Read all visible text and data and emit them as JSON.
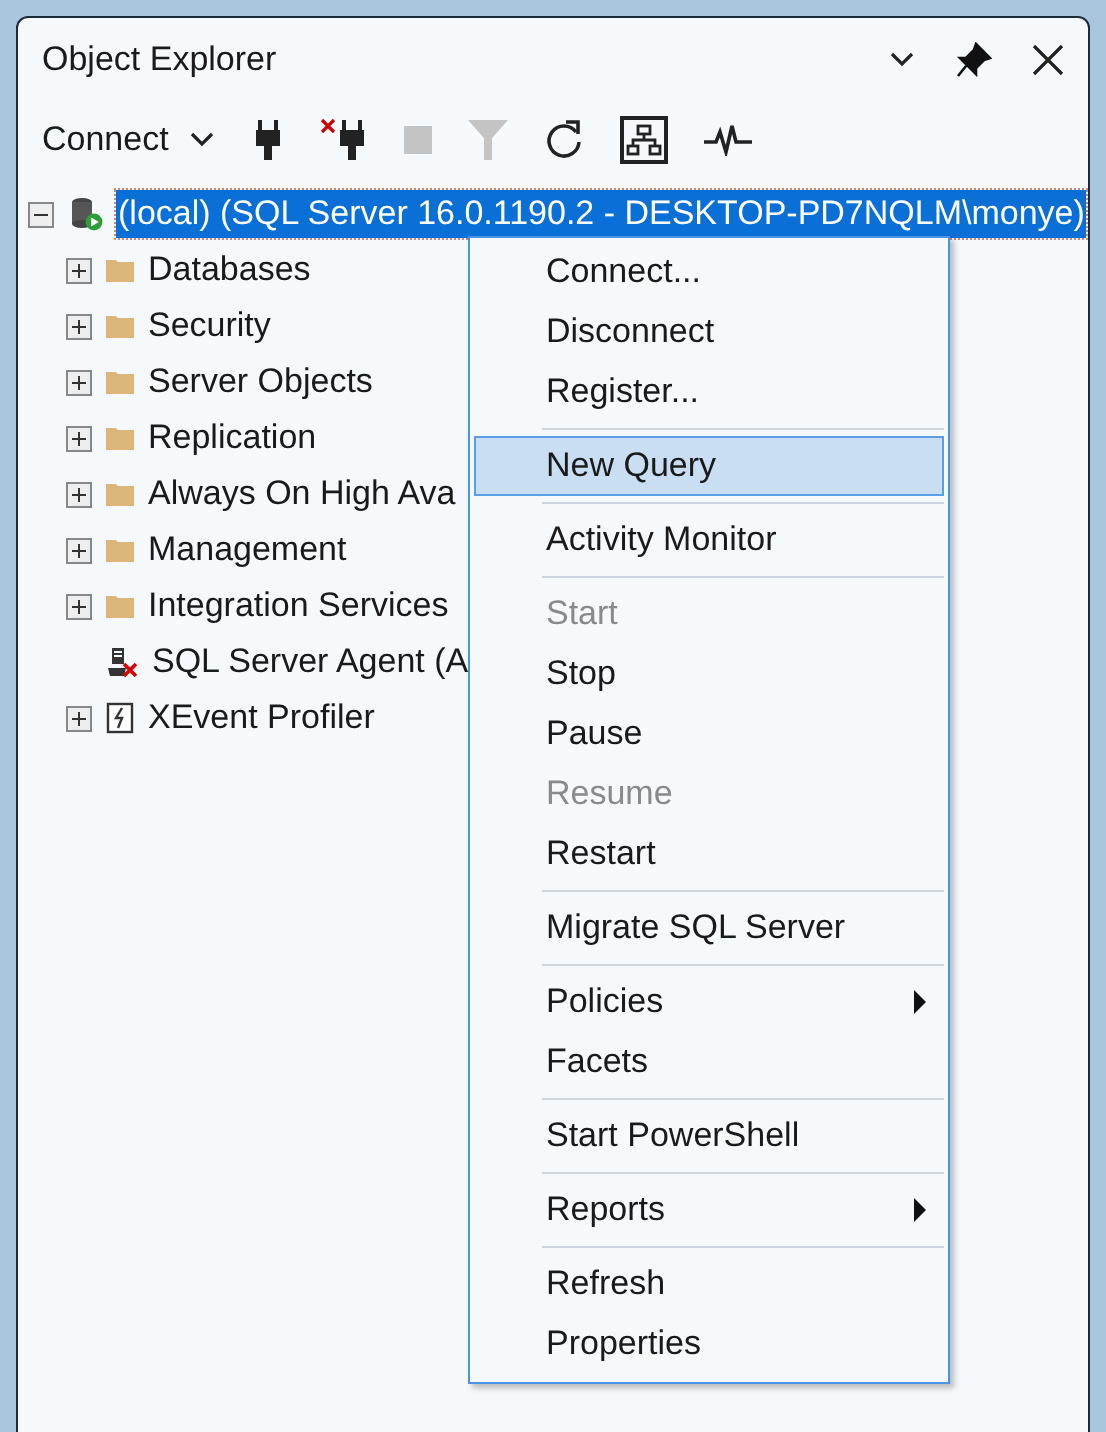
{
  "panel": {
    "title": "Object Explorer"
  },
  "toolbar": {
    "connect_label": "Connect",
    "tools": [
      {
        "kind": "connect",
        "disabled": false
      },
      {
        "kind": "disconnect",
        "disabled": false
      },
      {
        "kind": "stop",
        "disabled": true
      },
      {
        "kind": "filter",
        "disabled": true
      },
      {
        "kind": "refresh",
        "disabled": false
      },
      {
        "kind": "summary",
        "disabled": false
      },
      {
        "kind": "activity",
        "disabled": false
      }
    ]
  },
  "tree": {
    "root": {
      "label": "(local) (SQL Server 16.0.1190.2 - DESKTOP-PD7NQLM\\monye)",
      "expanded": true,
      "selected": true,
      "children": [
        {
          "label": "Databases",
          "kind": "folder",
          "expandable": true
        },
        {
          "label": "Security",
          "kind": "folder",
          "expandable": true
        },
        {
          "label": "Server Objects",
          "kind": "folder",
          "expandable": true
        },
        {
          "label": "Replication",
          "kind": "folder",
          "expandable": true
        },
        {
          "label": "Always On High Ava",
          "kind": "folder",
          "expandable": true
        },
        {
          "label": "Management",
          "kind": "folder",
          "expandable": true
        },
        {
          "label": "Integration Services",
          "kind": "folder",
          "expandable": true
        },
        {
          "label": "SQL Server Agent (A",
          "kind": "agent",
          "expandable": false
        },
        {
          "label": "XEvent Profiler",
          "kind": "xevent",
          "expandable": true
        }
      ]
    }
  },
  "context_menu": {
    "items": [
      {
        "kind": "item",
        "label": "Connect...",
        "disabled": false,
        "selected": false
      },
      {
        "kind": "item",
        "label": "Disconnect",
        "disabled": false,
        "selected": false
      },
      {
        "kind": "item",
        "label": "Register...",
        "disabled": false,
        "selected": false
      },
      {
        "kind": "separator"
      },
      {
        "kind": "item",
        "label": "New Query",
        "disabled": false,
        "selected": true
      },
      {
        "kind": "separator"
      },
      {
        "kind": "item",
        "label": "Activity Monitor",
        "disabled": false,
        "selected": false
      },
      {
        "kind": "separator"
      },
      {
        "kind": "item",
        "label": "Start",
        "disabled": true,
        "selected": false
      },
      {
        "kind": "item",
        "label": "Stop",
        "disabled": false,
        "selected": false
      },
      {
        "kind": "item",
        "label": "Pause",
        "disabled": false,
        "selected": false
      },
      {
        "kind": "item",
        "label": "Resume",
        "disabled": true,
        "selected": false
      },
      {
        "kind": "item",
        "label": "Restart",
        "disabled": false,
        "selected": false
      },
      {
        "kind": "separator"
      },
      {
        "kind": "item",
        "label": "Migrate SQL Server",
        "disabled": false,
        "selected": false
      },
      {
        "kind": "separator"
      },
      {
        "kind": "submenu",
        "label": "Policies",
        "disabled": false,
        "selected": false
      },
      {
        "kind": "item",
        "label": "Facets",
        "disabled": false,
        "selected": false
      },
      {
        "kind": "separator"
      },
      {
        "kind": "item",
        "label": "Start PowerShell",
        "disabled": false,
        "selected": false
      },
      {
        "kind": "separator"
      },
      {
        "kind": "submenu",
        "label": "Reports",
        "disabled": false,
        "selected": false
      },
      {
        "kind": "separator"
      },
      {
        "kind": "item",
        "label": "Refresh",
        "disabled": false,
        "selected": false
      },
      {
        "kind": "item",
        "label": "Properties",
        "disabled": false,
        "selected": false
      }
    ]
  }
}
